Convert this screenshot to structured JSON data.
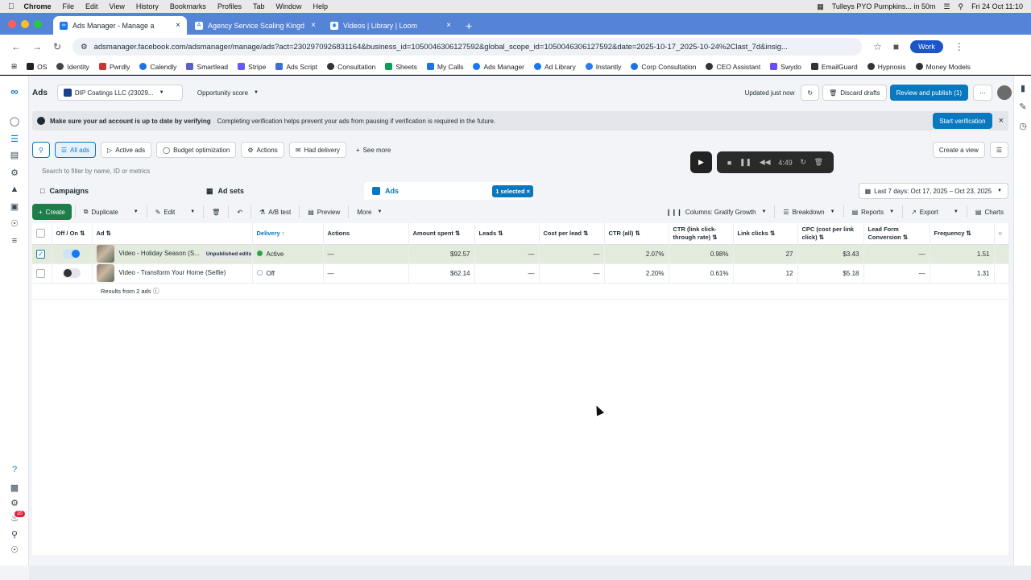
{
  "mac_menu": {
    "app": "Chrome",
    "items": [
      "File",
      "Edit",
      "View",
      "History",
      "Bookmarks",
      "Profiles",
      "Tab",
      "Window",
      "Help"
    ],
    "reminder": "Tulleys PYO Pumpkins... in 50m",
    "datetime": "Fri 24 Oct  11:10"
  },
  "browser": {
    "tabs": [
      {
        "title": "Ads Manager - Manage a",
        "active": true
      },
      {
        "title": "Agency Service Scaling Kingd",
        "active": false
      },
      {
        "title": "Videos | Library | Loom",
        "active": false
      }
    ],
    "url": "adsmanager.facebook.com/adsmanager/manage/ads?act=2302970926831164&business_id=1050046306127592&global_scope_id=1050046306127592&date=2025-10-17_2025-10-24%2Clast_7d&insig...",
    "profile": "Work"
  },
  "bookmarks": [
    "OS",
    "Identity",
    "Pwrdly",
    "Calendly",
    "Smartlead",
    "Stripe",
    "Ads Script",
    "Consultation",
    "Sheets",
    "My Calls",
    "Ads Manager",
    "Ad Library",
    "Instantly",
    "Corp Consultation",
    "CEO Assistant",
    "Swydo",
    "EmailGuard",
    "Hypnosis",
    "Money Models"
  ],
  "header": {
    "title": "Ads",
    "account": "DIP Coatings LLC (23029...",
    "opportunity": "Opportunity score",
    "updated": "Updated just now",
    "discard": "Discard drafts",
    "publish": "Review and publish (1)"
  },
  "banner": {
    "bold": "Make sure your ad account is up to date by verifying",
    "text": "Completing verification helps prevent your ads from pausing if verification is required in the future.",
    "button": "Start verification"
  },
  "filters": {
    "all_ads": "All ads",
    "active_ads": "Active ads",
    "budget": "Budget optimization",
    "actions": "Actions",
    "had_delivery": "Had delivery",
    "see_more": "See more",
    "create_view": "Create a view"
  },
  "search_placeholder": "Search to filter by name, ID or metrics",
  "loom": {
    "timer": "4:49"
  },
  "levels": {
    "campaigns": "Campaigns",
    "adsets": "Ad sets",
    "ads": "Ads",
    "selected": "1 selected"
  },
  "date_range": "Last 7 days: Oct 17, 2025 – Oct 23, 2025",
  "toolbar": {
    "create": "Create",
    "duplicate": "Duplicate",
    "edit": "Edit",
    "ab": "A/B test",
    "preview": "Preview",
    "more": "More",
    "columns": "Columns: Gratify Growth",
    "breakdown": "Breakdown",
    "reports": "Reports",
    "export": "Export",
    "charts": "Charts"
  },
  "table": {
    "headers": {
      "offon": "Off / On",
      "ad": "Ad",
      "delivery": "Delivery",
      "actions": "Actions",
      "amount": "Amount spent",
      "leads": "Leads",
      "cpl": "Cost per lead",
      "ctr": "CTR (all)",
      "ctr_link": "CTR (link click-through rate)",
      "link_clicks": "Link clicks",
      "cpc": "CPC (cost per link click)",
      "lead_form": "Lead Form Conversion",
      "frequency": "Frequency"
    },
    "rows": [
      {
        "name": "Video - Holiday Season (S...",
        "badge": "Unpublished edits",
        "delivery": "Active",
        "actions": "—",
        "amount": "$92.57",
        "leads": "—",
        "cpl": "—",
        "ctr": "2.07%",
        "ctr_link": "0.98%",
        "link_clicks": "27",
        "cpc": "$3.43",
        "lead_form": "—",
        "frequency": "1.51"
      },
      {
        "name": "Video - Transform Your Home (Selfie)",
        "badge": "",
        "delivery": "Off",
        "actions": "—",
        "amount": "$62.14",
        "leads": "—",
        "cpl": "—",
        "ctr": "2.20%",
        "ctr_link": "0.61%",
        "link_clicks": "12",
        "cpc": "$5.18",
        "lead_form": "—",
        "frequency": "1.31"
      }
    ],
    "results": "Results from 2 ads"
  },
  "notifications_count": "20"
}
